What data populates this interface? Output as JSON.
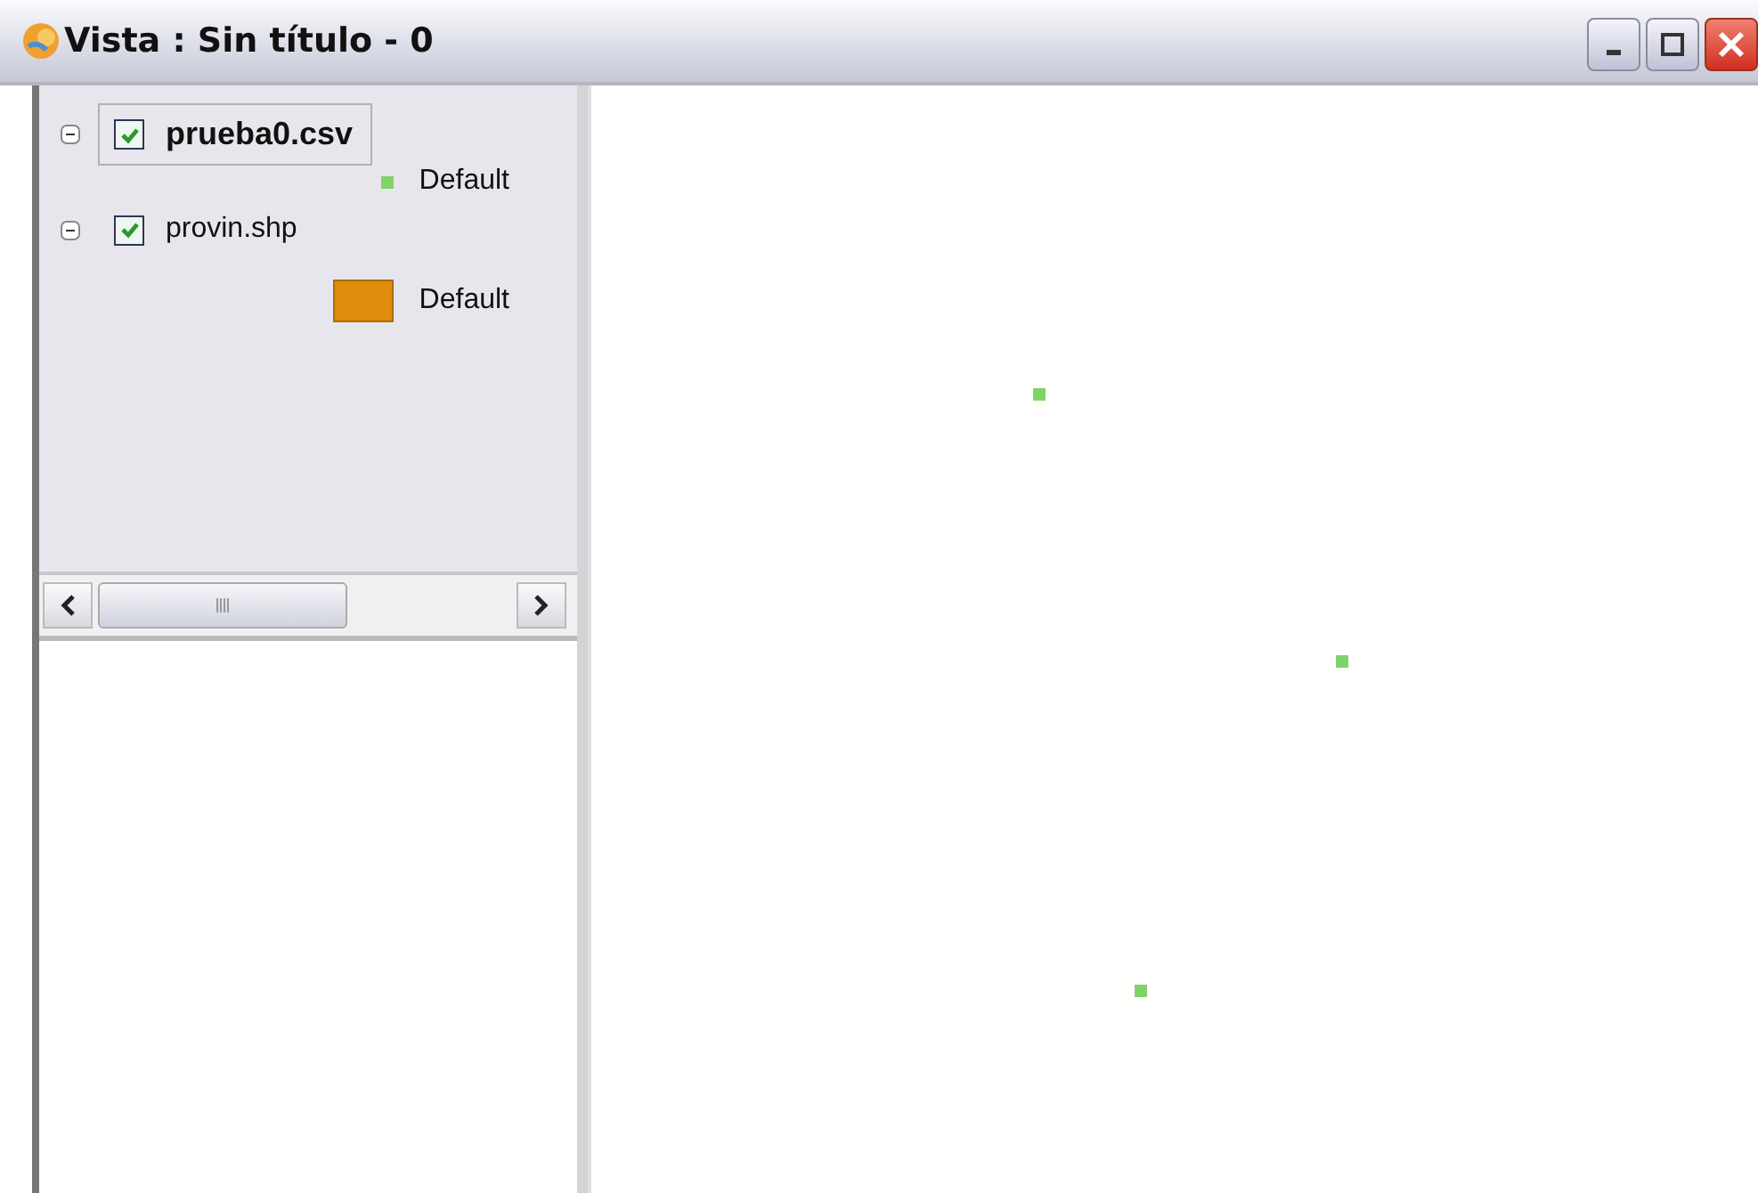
{
  "window": {
    "title": "Vista : Sin título - 0"
  },
  "layers": [
    {
      "name": "prueba0.csv",
      "selected": true,
      "checked": true,
      "expanded": true,
      "legend": {
        "label": "Default",
        "kind": "point",
        "color": "#7fd36a"
      }
    },
    {
      "name": "provin.shp",
      "selected": false,
      "checked": true,
      "expanded": true,
      "legend": {
        "label": "Default",
        "kind": "polygon",
        "color": "#e08c0c"
      }
    }
  ]
}
